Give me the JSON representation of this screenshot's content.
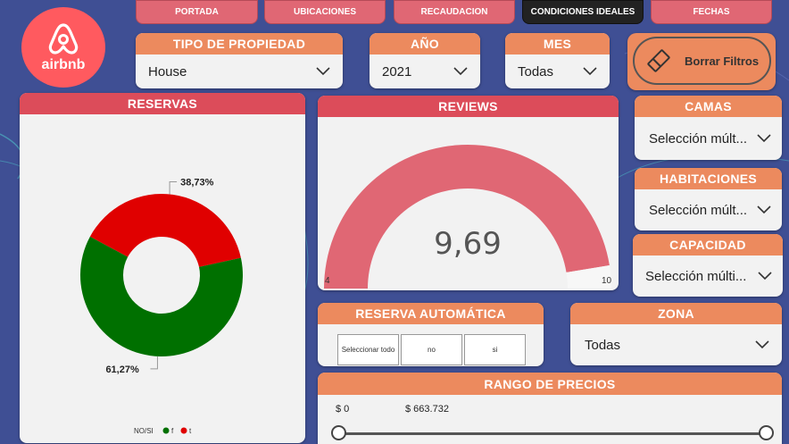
{
  "logo": {
    "text": "airbnb",
    "icon": "airbnb-logo-icon"
  },
  "nav": {
    "items": [
      "PORTADA",
      "UBICACIONES",
      "RECAUDACION",
      "CONDICIONES IDEALES",
      "FECHAS"
    ],
    "active": "CONDICIONES IDEALES"
  },
  "filters": {
    "tipo": {
      "title": "TIPO DE PROPIEDAD",
      "value": "House"
    },
    "anio": {
      "title": "AÑO",
      "value": "2021"
    },
    "mes": {
      "title": "MES",
      "value": "Todas"
    },
    "camas": {
      "title": "CAMAS",
      "value": "Selección múlt..."
    },
    "habitaciones": {
      "title": "HABITACIONES",
      "value": "Selección múlt..."
    },
    "capacidad": {
      "title": "CAPACIDAD",
      "value": "Selección múlti..."
    },
    "zona": {
      "title": "ZONA",
      "value": "Todas"
    }
  },
  "borrar": {
    "label": "Borrar Filtros",
    "icon": "eraser-icon"
  },
  "reserva_auto": {
    "title": "RESERVA AUTOMÁTICA",
    "options": [
      "Seleccionar todo",
      "no",
      "si"
    ]
  },
  "rango": {
    "title": "RANGO DE PRECIOS",
    "min": "$ 0",
    "max": "$ 663.732"
  },
  "colors": {
    "accent": "#ec8a5e",
    "brand": "#ff5a5f",
    "header_red": "#dc4c5a",
    "green": "#007000",
    "red": "#e00000",
    "gauge": "#e06774",
    "background": "#3f4f94"
  },
  "chart_data": [
    {
      "type": "pie",
      "title": "RESERVAS",
      "variant": "donut",
      "legend_title": "NO/SI",
      "legend_position": "bottom",
      "slices": [
        {
          "label": "f",
          "value": 61.27,
          "display": "61,27%",
          "color": "#007000"
        },
        {
          "label": "t",
          "value": 38.73,
          "display": "38,73%",
          "color": "#e00000"
        }
      ]
    },
    {
      "type": "gauge",
      "title": "REVIEWS",
      "value": 9.69,
      "display": "9,69",
      "min": 4,
      "max": 10,
      "min_label": "4",
      "max_label": "10",
      "color": "#e06774"
    }
  ]
}
